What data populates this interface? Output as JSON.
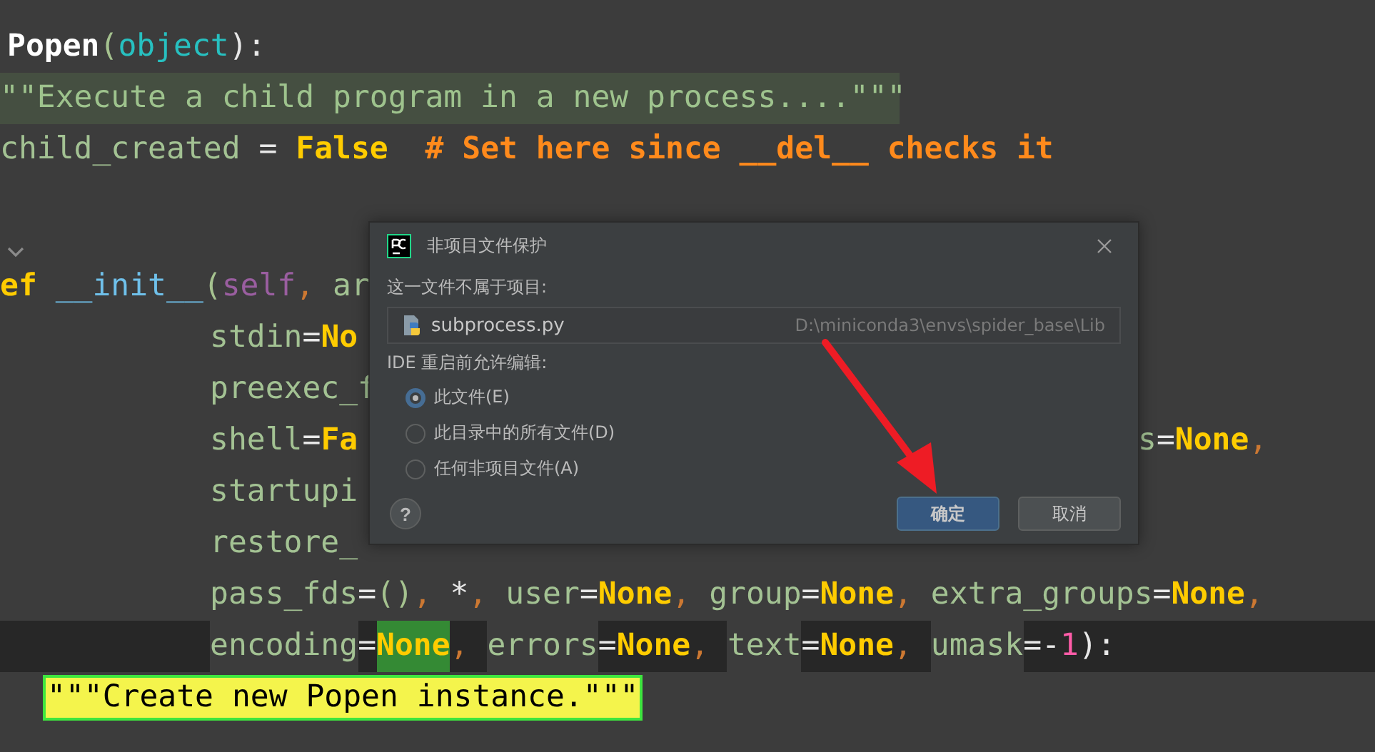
{
  "editor": {
    "lines": [
      {
        "kind": "top",
        "tokens": [
          {
            "t": "Popen",
            "kind": "name"
          },
          {
            "t": "(",
            "kind": "punct"
          },
          {
            "t": "object",
            "kind": "builtin"
          },
          {
            "t": "):",
            "kind": "op"
          }
        ]
      },
      {
        "kind": "highlight",
        "tokens": [
          {
            "t": "\"\"Execute a child program in a new process....\"\"\"",
            "kind": "str"
          }
        ]
      },
      {
        "kind": "edge",
        "tokens": [
          {
            "t": "child_created",
            "kind": "ident"
          },
          {
            "t": " = ",
            "kind": "op"
          },
          {
            "t": "False",
            "kind": "const"
          },
          {
            "t": "  # Set here since __del__ checks it",
            "kind": "comment"
          }
        ]
      },
      {
        "kind": "fold"
      },
      {
        "kind": "edge",
        "tokens": [
          {
            "t": "ef",
            "kind": "keyword"
          },
          {
            "t": " __init__",
            "kind": "func"
          },
          {
            "t": "(",
            "kind": "punct"
          },
          {
            "t": "self",
            "kind": "self"
          },
          {
            "t": ",",
            "kind": "comma"
          },
          {
            "t": " ar",
            "kind": "ident"
          }
        ]
      },
      {
        "kind": "body",
        "tokens": [
          {
            "t": "stdin",
            "kind": "ident"
          },
          {
            "t": "=",
            "kind": "op"
          },
          {
            "t": "No",
            "kind": "const"
          }
        ]
      },
      {
        "kind": "body",
        "tokens": [
          {
            "t": "preexec_f",
            "kind": "ident"
          }
        ]
      },
      {
        "kind": "body",
        "tokens": [
          {
            "t": "shell",
            "kind": "ident"
          },
          {
            "t": "=",
            "kind": "op"
          },
          {
            "t": "Fa",
            "kind": "const"
          }
        ],
        "tail": [
          {
            "t": "s",
            "kind": "ident"
          },
          {
            "t": "=",
            "kind": "op"
          },
          {
            "t": "None",
            "kind": "const"
          },
          {
            "t": ",",
            "kind": "comma"
          }
        ]
      },
      {
        "kind": "body",
        "tokens": [
          {
            "t": "startupi",
            "kind": "ident"
          }
        ]
      },
      {
        "kind": "body",
        "tokens": [
          {
            "t": "restore_",
            "kind": "ident"
          }
        ]
      },
      {
        "kind": "body",
        "tokens": [
          {
            "t": "pass_fds",
            "kind": "ident"
          },
          {
            "t": "=",
            "kind": "op"
          },
          {
            "t": "()",
            "kind": "punct"
          },
          {
            "t": ",",
            "kind": "comma"
          },
          {
            "t": " *",
            "kind": "op"
          },
          {
            "t": ",",
            "kind": "comma"
          },
          {
            "t": " user",
            "kind": "ident"
          },
          {
            "t": "=",
            "kind": "op"
          },
          {
            "t": "None",
            "kind": "const"
          },
          {
            "t": ",",
            "kind": "comma"
          },
          {
            "t": " group",
            "kind": "ident"
          },
          {
            "t": "=",
            "kind": "op"
          },
          {
            "t": "None",
            "kind": "const"
          },
          {
            "t": ",",
            "kind": "comma"
          },
          {
            "t": " extra_groups",
            "kind": "ident"
          },
          {
            "t": "=",
            "kind": "op"
          },
          {
            "t": "None",
            "kind": "const"
          },
          {
            "t": ",",
            "kind": "comma"
          }
        ]
      },
      {
        "kind": "current",
        "tokens": [
          {
            "t": "encoding",
            "kind": "ident"
          },
          {
            "t": "=",
            "kind": "op"
          },
          {
            "t": "None",
            "kind": "match"
          },
          {
            "t": ", ",
            "kind": "comma"
          },
          {
            "t": "errors",
            "kind": "ident"
          },
          {
            "t": "=",
            "kind": "op"
          },
          {
            "t": "None",
            "kind": "const"
          },
          {
            "t": ", ",
            "kind": "comma"
          },
          {
            "t": "text",
            "kind": "ident"
          },
          {
            "t": "=",
            "kind": "op"
          },
          {
            "t": "None",
            "kind": "const"
          },
          {
            "t": ", ",
            "kind": "comma"
          },
          {
            "t": "umask",
            "kind": "ident"
          },
          {
            "t": "=-",
            "kind": "op"
          },
          {
            "t": "1",
            "kind": "number"
          },
          {
            "t": "):",
            "kind": "op"
          }
        ]
      },
      {
        "kind": "doc",
        "tokens": [
          {
            "t": "\"\"\"Create new Popen instance.\"\"\"",
            "kind": "marked"
          }
        ]
      }
    ]
  },
  "dialog": {
    "title": "非项目文件保护",
    "file_label": "这一文件不属于项目:",
    "file": {
      "name": "subprocess.py",
      "path": "D:\\miniconda3\\envs\\spider_base\\Lib"
    },
    "options_label": "IDE 重启前允许编辑:",
    "options": [
      {
        "label": "此文件(E)",
        "selected": true
      },
      {
        "label": "此目录中的所有文件(D)",
        "selected": false
      },
      {
        "label": "任何非项目文件(A)",
        "selected": false
      }
    ],
    "help": "?",
    "buttons": [
      {
        "label": "确定",
        "kind": "primary"
      },
      {
        "label": "取消",
        "kind": "secondary"
      }
    ]
  }
}
